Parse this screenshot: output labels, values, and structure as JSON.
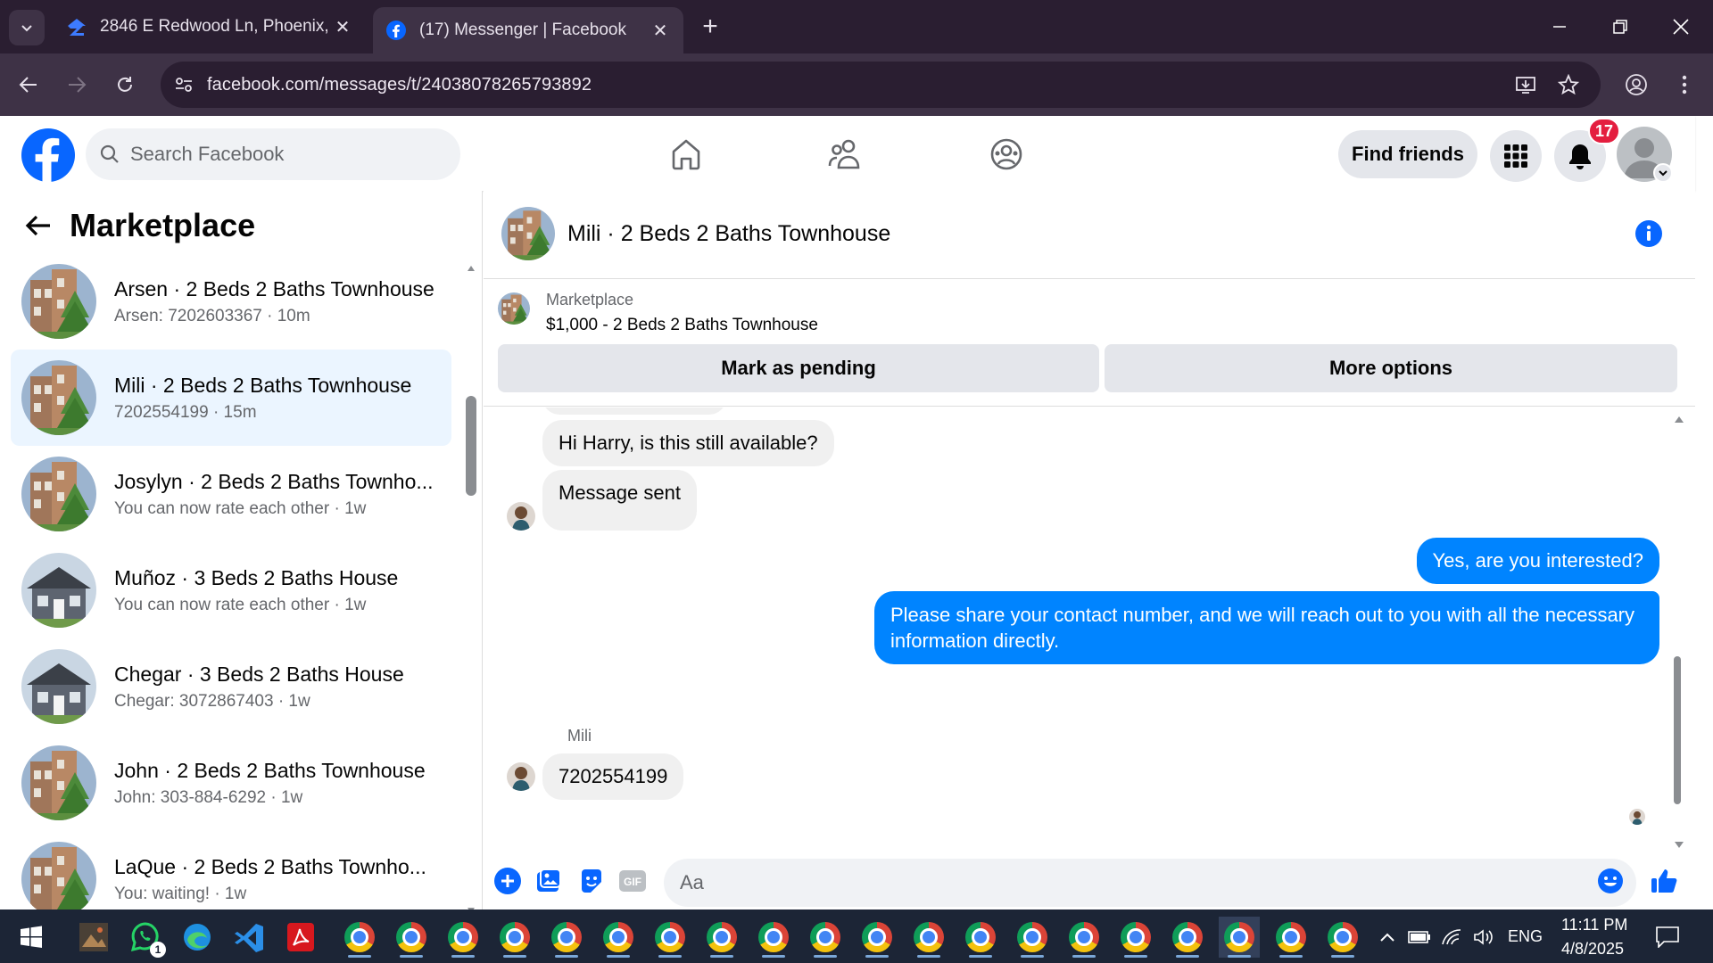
{
  "browser": {
    "tabs": [
      {
        "title": "2846 E Redwood Ln, Phoenix, A",
        "active": false
      },
      {
        "title": "(17) Messenger | Facebook",
        "active": true
      }
    ],
    "url": "facebook.com/messages/t/24038078265793892"
  },
  "fb": {
    "search_placeholder": "Search Facebook",
    "find_friends": "Find friends",
    "notification_count": "17"
  },
  "sidebar": {
    "title": "Marketplace",
    "conversations": [
      {
        "name": "Arsen · 2 Beds 2 Baths Townhouse",
        "sub": "Arsen: 7202603367 · 10m",
        "thumb": "townhouse"
      },
      {
        "name": "Mili · 2 Beds 2 Baths Townhouse",
        "sub": "7202554199 · 15m",
        "thumb": "townhouse",
        "active": true
      },
      {
        "name": "Josylyn · 2 Beds 2 Baths Townho...",
        "sub": "You can now rate each other · 1w",
        "thumb": "townhouse"
      },
      {
        "name": "Muñoz · 3 Beds 2 Baths House",
        "sub": "You can now rate each other · 1w",
        "thumb": "house"
      },
      {
        "name": "Chegar · 3 Beds 2 Baths House",
        "sub": "Chegar: 3072867403 · 1w",
        "thumb": "house"
      },
      {
        "name": "John · 2 Beds 2 Baths Townhouse",
        "sub": "John: 303-884-6292 · 1w",
        "thumb": "townhouse"
      },
      {
        "name": "LaQue · 2 Beds 2 Baths Townho...",
        "sub": "You: waiting! · 1w",
        "thumb": "townhouse"
      }
    ]
  },
  "chat": {
    "title": "Mili · 2 Beds 2 Baths Townhouse",
    "marketplace_label": "Marketplace",
    "listing": "$1,000 - 2 Beds 2 Baths Townhouse",
    "mark_pending": "Mark as pending",
    "more_options": "More options",
    "messages": [
      {
        "from": "them",
        "text": "Hi Harry, is this still available?"
      },
      {
        "from": "them",
        "text": "Message sent"
      },
      {
        "from": "me",
        "text": "Yes, are you interested?"
      },
      {
        "from": "me",
        "text": "Please share your contact number, and we will reach out to you with all the necessary information directly."
      },
      {
        "from": "them",
        "sender": "Mili",
        "text": "7202554199"
      }
    ],
    "input_placeholder": "Aa"
  },
  "taskbar": {
    "whatsapp_badge": "1",
    "lang": "ENG",
    "time": "11:11 PM",
    "date": "4/8/2025"
  },
  "colors": {
    "fb_blue": "#0866ff",
    "messenger_blue": "#0084ff",
    "chrome_dark": "#2a1e31",
    "chrome_toolbar": "#3e3246"
  }
}
